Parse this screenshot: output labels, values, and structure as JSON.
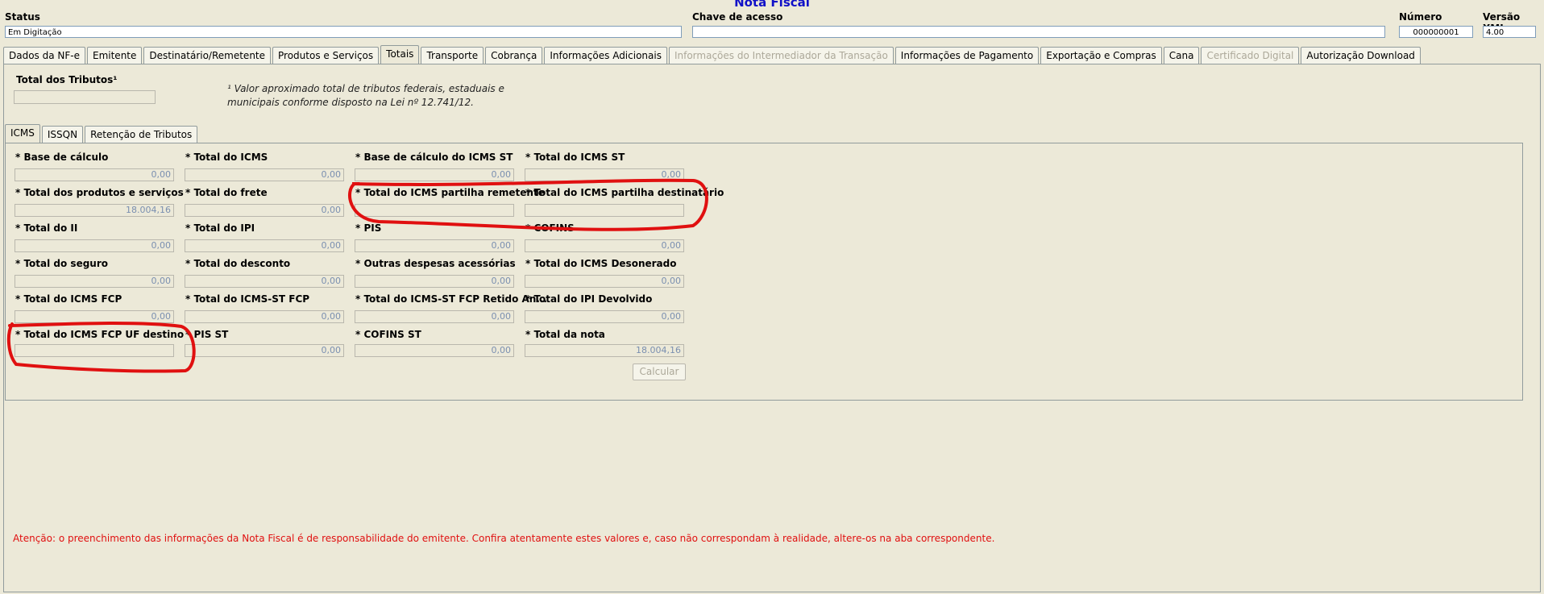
{
  "window_title": "Nota Fiscal",
  "header": {
    "status_label": "Status",
    "status_value": "Em Digitação",
    "chave_label": "Chave de acesso",
    "chave_value": "",
    "numero_label": "Número",
    "numero_value": "000000001",
    "versao_label": "Versão XML",
    "versao_value": "4.00"
  },
  "tabs": [
    {
      "label": "Dados da NF-e"
    },
    {
      "label": "Emitente"
    },
    {
      "label": "Destinatário/Remetente"
    },
    {
      "label": "Produtos e Serviços"
    },
    {
      "label": "Totais"
    },
    {
      "label": "Transporte"
    },
    {
      "label": "Cobrança"
    },
    {
      "label": "Informações Adicionais"
    },
    {
      "label": "Informações do Intermediador da Transação"
    },
    {
      "label": "Informações de Pagamento"
    },
    {
      "label": "Exportação e Compras"
    },
    {
      "label": "Cana"
    },
    {
      "label": "Certificado Digital"
    },
    {
      "label": "Autorização Download"
    }
  ],
  "tributos": {
    "label": "Total dos Tributos¹",
    "value": "",
    "note_line1": "¹ Valor aproximado total de tributos federais, estaduais e",
    "note_line2": "municipais conforme disposto na Lei nº 12.741/12."
  },
  "subtabs": [
    {
      "label": "ICMS"
    },
    {
      "label": "ISSQN"
    },
    {
      "label": "Retenção de Tributos"
    }
  ],
  "fields": {
    "r1c1": {
      "label": "* Base de cálculo",
      "value": "0,00"
    },
    "r1c2": {
      "label": "* Total do ICMS",
      "value": "0,00"
    },
    "r1c3": {
      "label": "* Base de cálculo do ICMS ST",
      "value": "0,00"
    },
    "r1c4": {
      "label": "* Total do ICMS ST",
      "value": "0,00"
    },
    "r2c1": {
      "label": "* Total dos produtos e serviços",
      "value": "18.004,16"
    },
    "r2c2": {
      "label": "* Total do frete",
      "value": "0,00"
    },
    "r2c3": {
      "label": "* Total do ICMS partilha remetente",
      "value": ""
    },
    "r2c4": {
      "label": "* Total do ICMS partilha destinatário",
      "value": ""
    },
    "r3c1": {
      "label": "* Total do II",
      "value": "0,00"
    },
    "r3c2": {
      "label": "* Total do IPI",
      "value": "0,00"
    },
    "r3c3": {
      "label": "* PIS",
      "value": "0,00"
    },
    "r3c4": {
      "label": "* COFINS",
      "value": "0,00"
    },
    "r4c1": {
      "label": "* Total do seguro",
      "value": "0,00"
    },
    "r4c2": {
      "label": "* Total do desconto",
      "value": "0,00"
    },
    "r4c3": {
      "label": "* Outras despesas acessórias",
      "value": "0,00"
    },
    "r4c4": {
      "label": "* Total do ICMS Desonerado",
      "value": "0,00"
    },
    "r5c1": {
      "label": "* Total do ICMS FCP",
      "value": "0,00"
    },
    "r5c2": {
      "label": "* Total do ICMS-ST FCP",
      "value": "0,00"
    },
    "r5c3": {
      "label": "* Total do ICMS-ST FCP Retido An...",
      "value": "0,00"
    },
    "r5c4": {
      "label": "* Total do IPI Devolvido",
      "value": "0,00"
    },
    "r6c1": {
      "label": "* Total do ICMS FCP UF destino",
      "value": ""
    },
    "r6c2": {
      "label": "* PIS ST",
      "value": "0,00"
    },
    "r6c3": {
      "label": "* COFINS ST",
      "value": "0,00"
    },
    "r6c4": {
      "label": "* Total da nota",
      "value": "18.004,16"
    }
  },
  "calcular_label": "Calcular",
  "warning": "Atenção: o preenchimento das informações da Nota Fiscal é de responsabilidade do emitente. Confira atentamente estes valores e, caso não correspondam à realidade, altere-os na aba correspondente.",
  "colors": {
    "background": "#ece9d8",
    "title": "#1010c8",
    "warning": "#e01010",
    "annotation": "#e01010"
  }
}
